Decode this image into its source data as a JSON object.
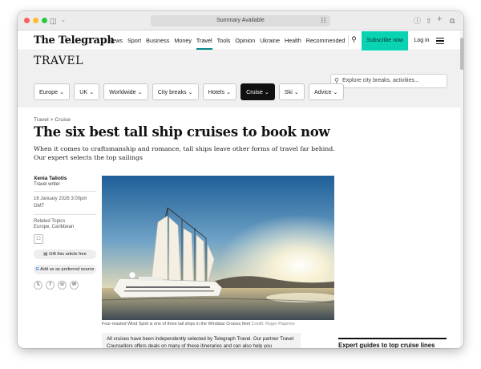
{
  "browser": {
    "url": "Summary Available"
  },
  "site": {
    "logo": "The Telegraph",
    "nav": [
      "News",
      "Sport",
      "Business",
      "Money",
      "Travel",
      "Tools",
      "Opinion",
      "Ukraine",
      "Health",
      "Recommended"
    ],
    "subscribe_label": "Subscribe now",
    "login_label": "Log in"
  },
  "section": {
    "title": "TRAVEL",
    "search_placeholder": "Explore city breaks, activities...",
    "filters": [
      "Europe",
      "UK",
      "Worldwide",
      "City breaks",
      "Hotels",
      "Cruise",
      "Ski",
      "Advice"
    ],
    "active_filter": "Cruise"
  },
  "article": {
    "breadcrumb": "Travel > Cruise",
    "headline": "The six best tall ship cruises to book now",
    "standfirst": "When it comes to craftsmanship and romance, tall ships leave other forms of travel far behind. Our expert selects the top sailings",
    "author": "Xenia Taliotis",
    "author_role": "Travel writer",
    "date": "16 January 2026 3:00pm GMT",
    "related_label": "Related Topics",
    "related_topics": "Europe, Caribbean",
    "gift_label": "Gift this article free",
    "preferred_label": "Add us as preferred source",
    "caption": "Four-masted Wind Spirit is one of three tall ships in the Windstar Cruises fleet",
    "credit": "Credit: Roger Paperno",
    "disclaimer": "All cruises have been independently selected by Telegraph Travel. Our partner Travel Counsellors offers deals on many of these itineraries and can also help you personalise your selection. The Telegraph will earn a commission if you book via the links below but this",
    "sidebar_heading": "Expert guides to top cruise lines"
  },
  "colors": {
    "accent": "#0ad3b3",
    "active_underline": "#0a8a8a"
  }
}
